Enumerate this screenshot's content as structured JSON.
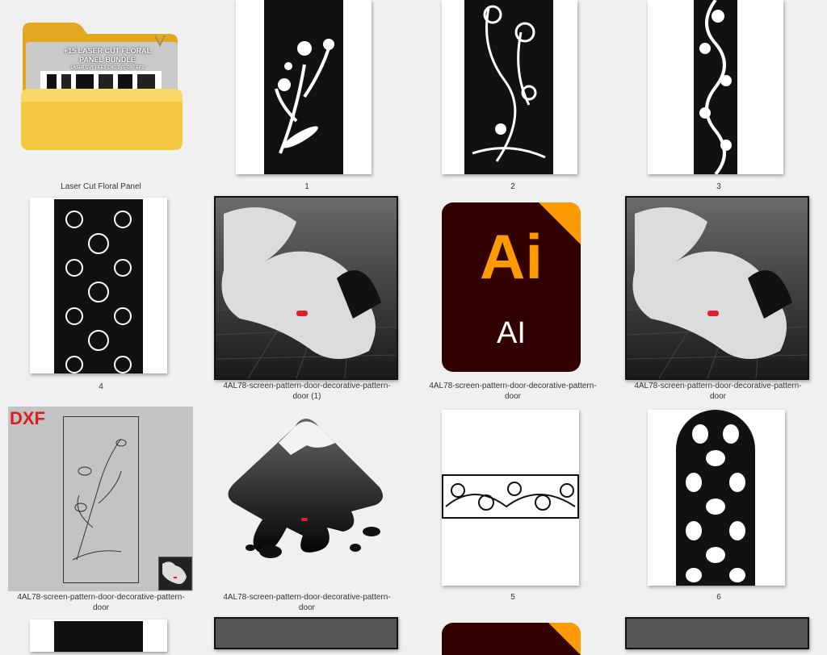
{
  "folder": {
    "caption": "Laser Cut Floral Panel",
    "preview_title_1": "+15 LASER CUT FLORAL",
    "preview_title_2": "PANEL BUNDLE",
    "preview_subtitle": "LASER CUT FILES CNC SVG DXF EPS"
  },
  "files": [
    {
      "caption": "1"
    },
    {
      "caption": "2"
    },
    {
      "caption": "3"
    },
    {
      "caption": "4"
    },
    {
      "caption_line1": "4AL78-screen-pattern-door-decorative-pattern-",
      "caption_line2": "door (1)"
    },
    {
      "caption_line1": "4AL78-screen-pattern-door-decorative-pattern-",
      "caption_line2": "door",
      "icon_text": "Ai",
      "icon_sub": "AI"
    },
    {
      "caption_line1": "4AL78-screen-pattern-door-decorative-pattern-",
      "caption_line2": "door"
    },
    {
      "caption_line1": "4AL78-screen-pattern-door-decorative-pattern-",
      "caption_line2": "door",
      "badge": "DXF"
    },
    {
      "caption_line1": "4AL78-screen-pattern-door-decorative-pattern-",
      "caption_line2": "door"
    },
    {
      "caption": "5"
    },
    {
      "caption": "6"
    }
  ],
  "colors": {
    "background": "#f0f0f0",
    "folder_yellow": "#f5c842",
    "ai_bg": "#330000",
    "ai_orange": "#ff9a00",
    "dxf_red": "#d81f26"
  }
}
